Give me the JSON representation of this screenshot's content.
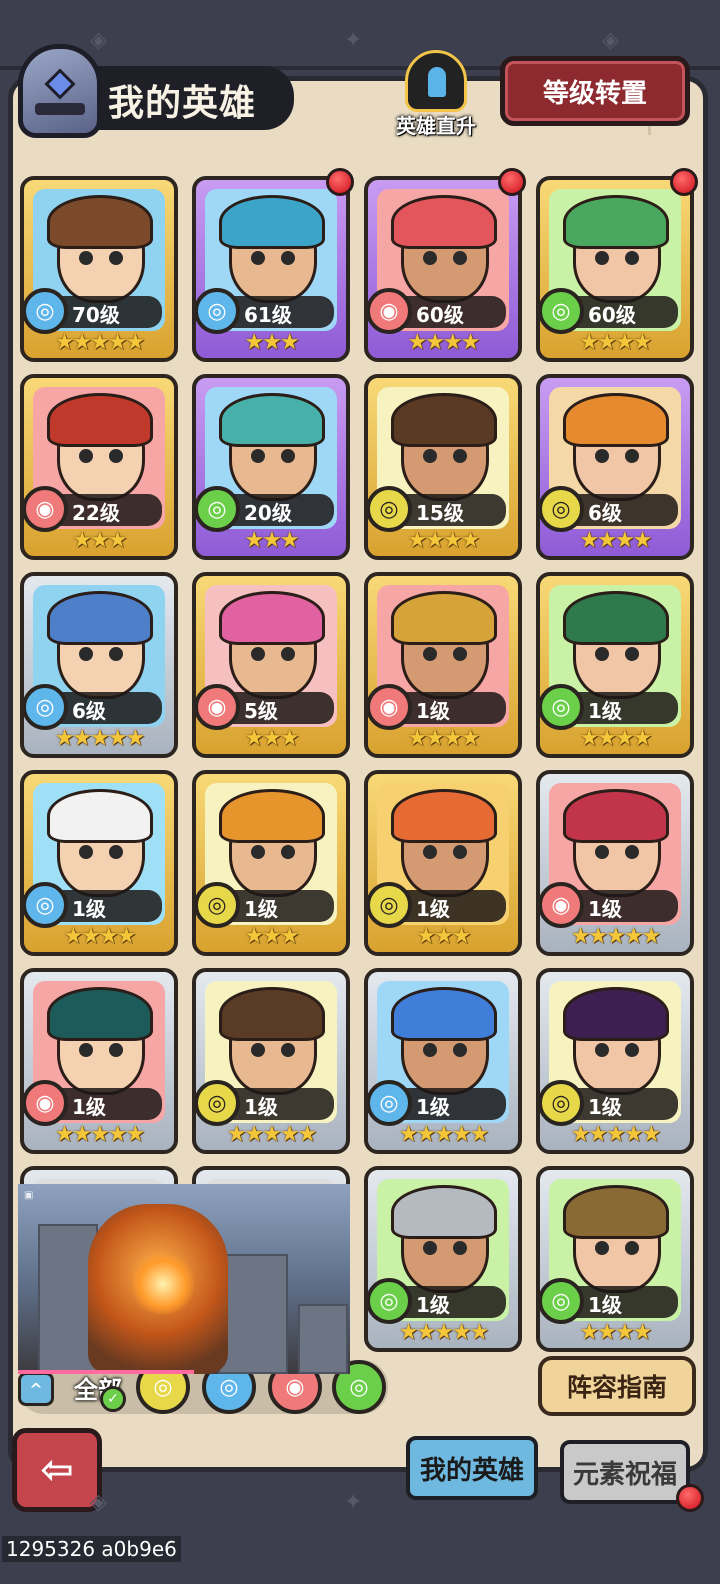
{
  "header": {
    "title": "我的英雄",
    "promote_label": "英雄直升",
    "level_transfer": "等级转置"
  },
  "colors": {
    "water": "#5fb6ea",
    "fire": "#f07a7a",
    "earth": "#e7d84a",
    "wind": "#6ccf4a",
    "gold_frame": "#f0c45a",
    "purple_frame": "#a97ae6",
    "silver_frame": "#c9d0d8",
    "red_button": "#8d2a30"
  },
  "element_icons": {
    "water": "water-swirl-icon",
    "fire": "fire-drop-icon",
    "earth": "earth-swirl-icon",
    "wind": "wind-swirl-icon"
  },
  "heroes": [
    {
      "level": "70级",
      "element": "water",
      "stars": 5,
      "frame": "gold",
      "red_dot": false
    },
    {
      "level": "61级",
      "element": "water",
      "stars": 3,
      "frame": "purple",
      "red_dot": true
    },
    {
      "level": "60级",
      "element": "fire",
      "stars": 4,
      "frame": "purple",
      "red_dot": true
    },
    {
      "level": "60级",
      "element": "wind",
      "stars": 4,
      "frame": "gold",
      "red_dot": true
    },
    {
      "level": "22级",
      "element": "fire",
      "stars": 3,
      "frame": "gold",
      "red_dot": false
    },
    {
      "level": "20级",
      "element": "wind",
      "stars": 3,
      "frame": "purple",
      "red_dot": false
    },
    {
      "level": "15级",
      "element": "earth",
      "stars": 4,
      "frame": "gold",
      "red_dot": false
    },
    {
      "level": "6级",
      "element": "earth",
      "stars": 4,
      "frame": "purple",
      "red_dot": false
    },
    {
      "level": "6级",
      "element": "water",
      "stars": 5,
      "frame": "silver",
      "red_dot": false
    },
    {
      "level": "5级",
      "element": "fire",
      "stars": 3,
      "frame": "gold",
      "red_dot": false
    },
    {
      "level": "1级",
      "element": "fire",
      "stars": 4,
      "frame": "gold",
      "red_dot": false
    },
    {
      "level": "1级",
      "element": "wind",
      "stars": 4,
      "frame": "gold",
      "red_dot": false
    },
    {
      "level": "1级",
      "element": "water",
      "stars": 4,
      "frame": "gold",
      "red_dot": false
    },
    {
      "level": "1级",
      "element": "earth",
      "stars": 3,
      "frame": "gold",
      "red_dot": false
    },
    {
      "level": "1级",
      "element": "earth",
      "stars": 3,
      "frame": "gold",
      "red_dot": false
    },
    {
      "level": "1级",
      "element": "fire",
      "stars": 5,
      "frame": "silver",
      "red_dot": false
    },
    {
      "level": "1级",
      "element": "fire",
      "stars": 5,
      "frame": "silver",
      "red_dot": false
    },
    {
      "level": "1级",
      "element": "earth",
      "stars": 5,
      "frame": "silver",
      "red_dot": false
    },
    {
      "level": "1级",
      "element": "water",
      "stars": 5,
      "frame": "silver",
      "red_dot": false
    },
    {
      "level": "1级",
      "element": "earth",
      "stars": 5,
      "frame": "silver",
      "red_dot": false
    },
    {
      "level": "",
      "element": "",
      "stars": 0,
      "frame": "silver",
      "red_dot": false
    },
    {
      "level": "",
      "element": "",
      "stars": 0,
      "frame": "silver",
      "red_dot": false
    },
    {
      "level": "1级",
      "element": "wind",
      "stars": 5,
      "frame": "silver",
      "red_dot": false
    },
    {
      "level": "1级",
      "element": "wind",
      "stars": 4,
      "frame": "silver",
      "red_dot": false
    }
  ],
  "video": {
    "progress": 0.53
  },
  "filters": {
    "collapse": "^",
    "all_label": "全部",
    "check": "✓"
  },
  "guide_button": "阵容指南",
  "tabs": {
    "my_heroes": "我的英雄",
    "element_blessing": "元素祝福"
  },
  "back": "⇦",
  "footer_id": "1295326 a0b9e6"
}
